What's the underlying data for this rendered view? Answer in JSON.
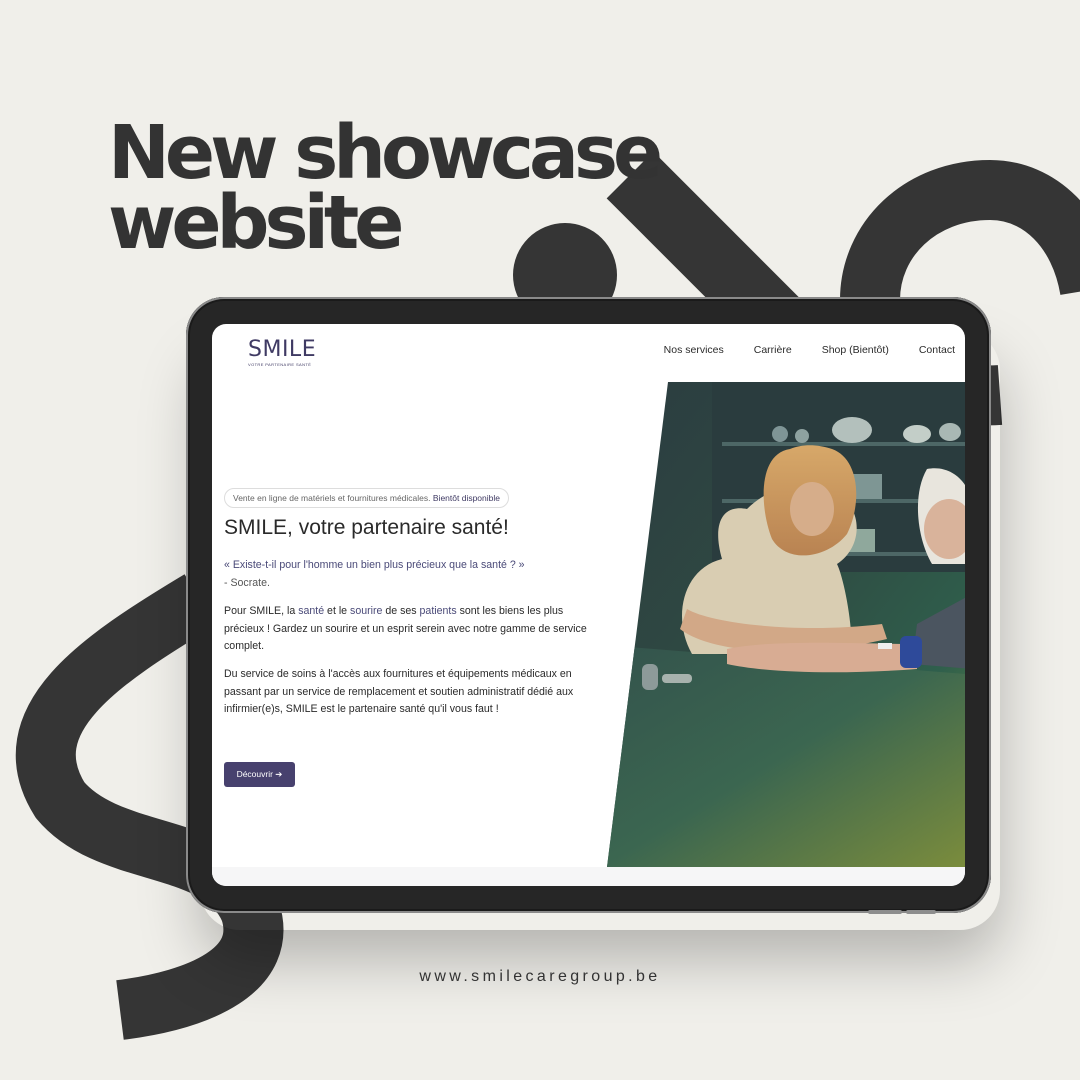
{
  "headline": {
    "line1": "New showcase",
    "line2": "website"
  },
  "website": {
    "logo": {
      "name": "SMILE",
      "tagline": "VOTRE PARTENAIRE SANTÉ"
    },
    "nav": [
      "Nos services",
      "Carrière",
      "Shop (Bientôt)",
      "Contact"
    ],
    "pill": {
      "text": "Vente en ligne de matériels et fournitures médicales.",
      "highlight": "Bientôt disponible"
    },
    "hero_title": "SMILE, votre partenaire santé!",
    "quote": {
      "text": "« Existe-t-il pour l'homme un bien plus précieux que la santé ? »",
      "author": "- Socrate."
    },
    "paragraph1": {
      "a": "Pour SMILE, la ",
      "b": "santé",
      "c": " et le ",
      "d": "sourire",
      "e": " de ses ",
      "f": "patients",
      "g": " sont les biens les plus précieux ! Gardez un sourire et un esprit serein avec notre gamme de service complet."
    },
    "paragraph2": "Du service de soins à l'accès aux fournitures et équipements médicaux en passant par un service de remplacement et soutien administratif dédié aux infirmier(e)s, SMILE est le partenaire santé qu'il vous faut !",
    "cta_label": "Découvrir ➔"
  },
  "footer_url": "www.smilecaregroup.be",
  "colors": {
    "background": "#f0efea",
    "dark": "#333333",
    "brand": "#3f3a63",
    "button": "#47416e"
  }
}
